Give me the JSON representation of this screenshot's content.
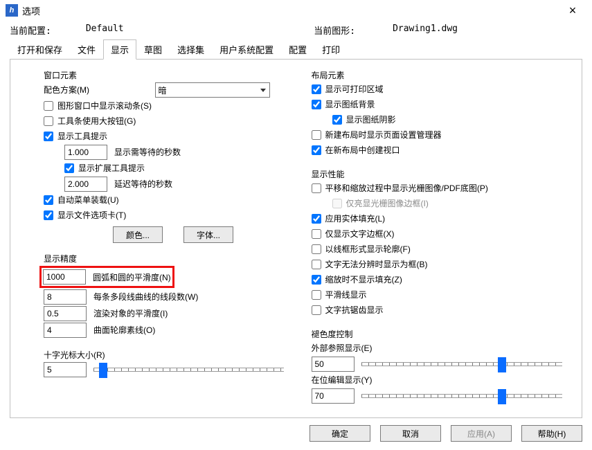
{
  "title": "选项",
  "close_label": "×",
  "info": {
    "config_label": "当前配置:",
    "config_value": "Default",
    "drawing_label": "当前图形:",
    "drawing_value": "Drawing1.dwg"
  },
  "tabs": {
    "open_save": "打开和保存",
    "file": "文件",
    "display": "显示",
    "draft": "草图",
    "select_set": "选择集",
    "user_sys": "用户系统配置",
    "config": "配置",
    "print": "打印"
  },
  "window_elements": {
    "title": "窗口元素",
    "color_scheme_label": "配色方案(M)",
    "color_scheme_value": "暗",
    "scrollbars": "图形窗口中显示滚动条(S)",
    "toolbar_big_buttons": "工具条使用大按钮(G)",
    "show_tooltips": "显示工具提示",
    "seconds_tooltip": "显示需等待的秒数",
    "seconds_tooltip_val": "1.000",
    "show_ext_tooltips": "显示扩展工具提示",
    "delay_seconds": "延迟等待的秒数",
    "delay_seconds_val": "2.000",
    "auto_menu_load": "自动菜单装载(U)",
    "show_file_tabs": "显示文件选项卡(T)",
    "color_btn": "颜色...",
    "font_btn": "字体..."
  },
  "display_precision": {
    "title": "显示精度",
    "arc_smoothness": "圆弧和圆的平滑度(N)",
    "arc_val": "1000",
    "polyline_segments": "每条多段线曲线的线段数(W)",
    "polyline_val": "8",
    "render_smoothness": "渲染对象的平滑度(I)",
    "render_val": "0.5",
    "surface_contour": "曲面轮廓素线(O)",
    "surface_val": "4"
  },
  "crosshair": {
    "title": "十字光标大小(R)",
    "value": "5",
    "percent": 5
  },
  "layout_elements": {
    "title": "布局元素",
    "show_print_area": "显示可打印区域",
    "show_paper_bg": "显示图纸背景",
    "show_paper_shadow": "显示图纸阴影",
    "new_layout_page_setup": "新建布局时显示页面设置管理器",
    "create_viewport": "在新布局中创建视口"
  },
  "display_perf": {
    "title": "显示性能",
    "pan_zoom_raster": "平移和缩放过程中显示光栅图像/PDF底图(P)",
    "highlight_raster_frame": "仅亮显光栅图像边框(I)",
    "solid_fill": "应用实体填充(L)",
    "text_frame": "仅显示文字边框(X)",
    "outline_frame": "以线框形式显示轮廓(F)",
    "text_as_box": "文字无法分辨时显示为框(B)",
    "zoom_no_fill": "缩放时不显示填充(Z)",
    "smooth_line": "平滑线显示",
    "text_aa": "文字抗锯齿显示"
  },
  "fade_control": {
    "title": "褪色度控制",
    "xref_label": "外部参照显示(E)",
    "xref_val": "50",
    "xref_percent": 70,
    "inplace_label": "在位编辑显示(Y)",
    "inplace_val": "70",
    "inplace_percent": 70
  },
  "footer": {
    "ok": "确定",
    "cancel": "取消",
    "apply": "应用(A)",
    "help": "帮助(H)"
  }
}
